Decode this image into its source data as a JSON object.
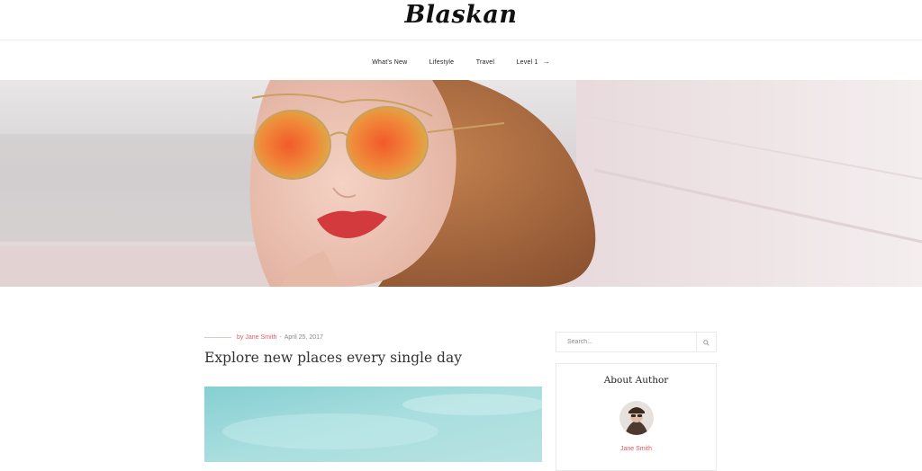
{
  "site": {
    "logo": "Blaskan"
  },
  "nav": {
    "items": [
      {
        "label": "What's New"
      },
      {
        "label": "Lifestyle"
      },
      {
        "label": "Travel"
      },
      {
        "label": "Level 1",
        "has_submenu": true
      }
    ]
  },
  "post": {
    "author": "by Jane Smith",
    "separator": "-",
    "date": "April 25, 2017",
    "title": "Explore new places every single day"
  },
  "sidebar": {
    "search": {
      "placeholder": "Search..."
    },
    "about": {
      "title": "About Author",
      "author_name": "Jane Smith"
    }
  },
  "colors": {
    "accent": "#e05a5a",
    "border": "#eaeaea",
    "text": "#222222"
  },
  "icons": {
    "search": "search-icon",
    "submenu": "chevron-right-icon"
  }
}
